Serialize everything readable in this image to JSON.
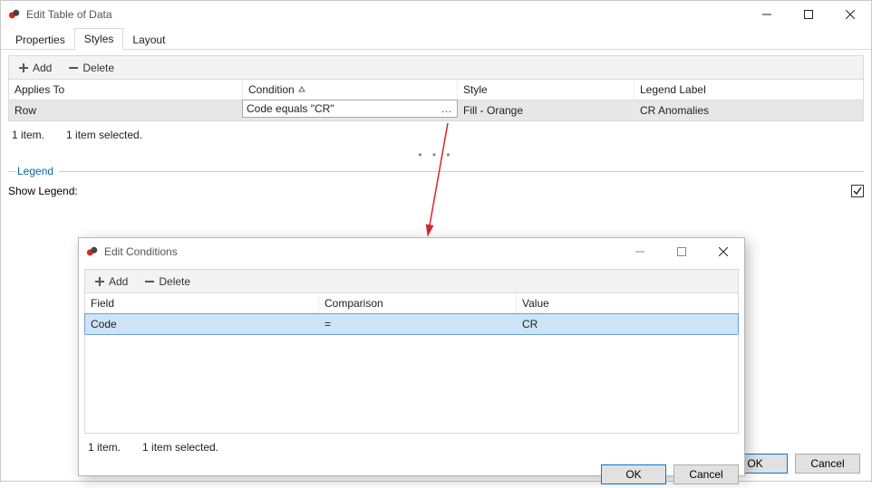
{
  "main": {
    "title": "Edit Table of Data",
    "tabs": {
      "properties": "Properties",
      "styles": "Styles",
      "layout": "Layout"
    },
    "toolbar": {
      "add": "Add",
      "delete": "Delete"
    },
    "columns": {
      "applies": "Applies To",
      "condition": "Condition",
      "style": "Style",
      "legend": "Legend Label"
    },
    "row": {
      "applies": "Row",
      "condition": "Code equals \"CR\"",
      "style": "Fill - Orange",
      "legend": "CR Anomalies"
    },
    "status": {
      "count": "1 item.",
      "selected": "1 item selected."
    },
    "legend_section": {
      "header": "Legend",
      "show_label": "Show Legend:",
      "show_checked": true
    },
    "buttons": {
      "ok": "OK",
      "cancel": "Cancel"
    }
  },
  "child": {
    "title": "Edit Conditions",
    "toolbar": {
      "add": "Add",
      "delete": "Delete"
    },
    "columns": {
      "field": "Field",
      "comparison": "Comparison",
      "value": "Value"
    },
    "row": {
      "field": "Code",
      "comparison": "=",
      "value": "CR"
    },
    "status": {
      "count": "1 item.",
      "selected": "1 item selected."
    },
    "buttons": {
      "ok": "OK",
      "cancel": "Cancel"
    }
  }
}
